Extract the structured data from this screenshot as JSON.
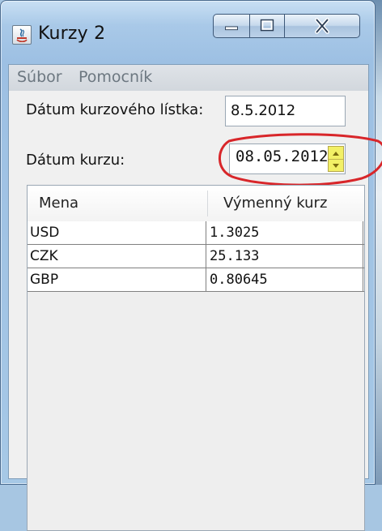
{
  "window": {
    "title": "Kurzy 2",
    "icons": {
      "app": "java-app-icon",
      "minimize": "minimize-icon",
      "maximize": "maximize-icon",
      "close": "close-icon"
    }
  },
  "menu": {
    "file": "Súbor",
    "help": "Pomocník"
  },
  "form": {
    "list_date_label": "Dátum kurzového lístka:",
    "list_date_value": "8.5.2012",
    "rate_date_label": "Dátum kurzu:",
    "rate_date_value": "08.05.2012"
  },
  "table": {
    "columns": [
      "Mena",
      "Výmenný kurz"
    ],
    "rows": [
      [
        "USD",
        "1.3025"
      ],
      [
        "CZK",
        "25.133"
      ],
      [
        "GBP",
        "0.80645"
      ]
    ]
  },
  "colors": {
    "annotation": "#d8262a",
    "spinner_highlight": "#f2f066"
  }
}
